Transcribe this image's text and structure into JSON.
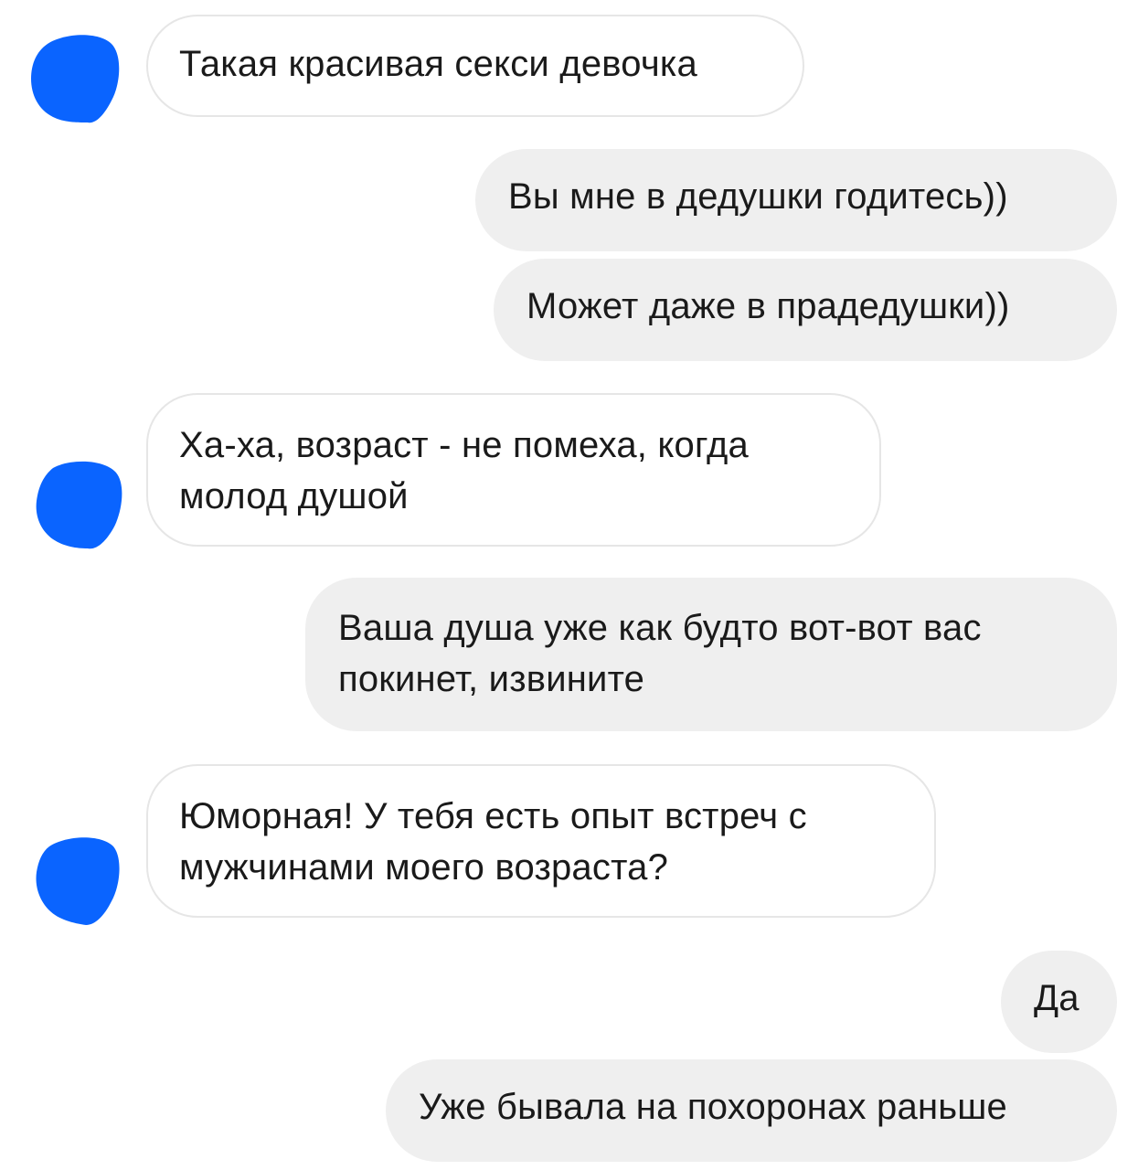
{
  "chat": {
    "accent_color": "#0a64ff",
    "messages": [
      {
        "side": "incoming",
        "lines": [
          "Такая красивая секси девочка"
        ]
      },
      {
        "side": "outgoing",
        "lines": [
          "Вы мне в дедушки годитесь))"
        ]
      },
      {
        "side": "outgoing",
        "lines": [
          "Может даже в прадедушки))"
        ]
      },
      {
        "side": "incoming",
        "lines": [
          "Ха-ха, возраст - не помеха, когда",
          "молод душой"
        ]
      },
      {
        "side": "outgoing",
        "lines": [
          "Ваша душа уже как будто вот-вот вас",
          "покинет, извините"
        ]
      },
      {
        "side": "incoming",
        "lines": [
          "Юморная! У тебя есть опыт встреч с",
          "мужчинами моего возраста?"
        ]
      },
      {
        "side": "outgoing",
        "lines": [
          "Да"
        ]
      },
      {
        "side": "outgoing",
        "lines": [
          "Уже бывала на похоронах раньше"
        ]
      }
    ],
    "avatars": [
      "redacted-avatar-icon",
      "redacted-avatar-icon",
      "redacted-avatar-icon"
    ]
  }
}
